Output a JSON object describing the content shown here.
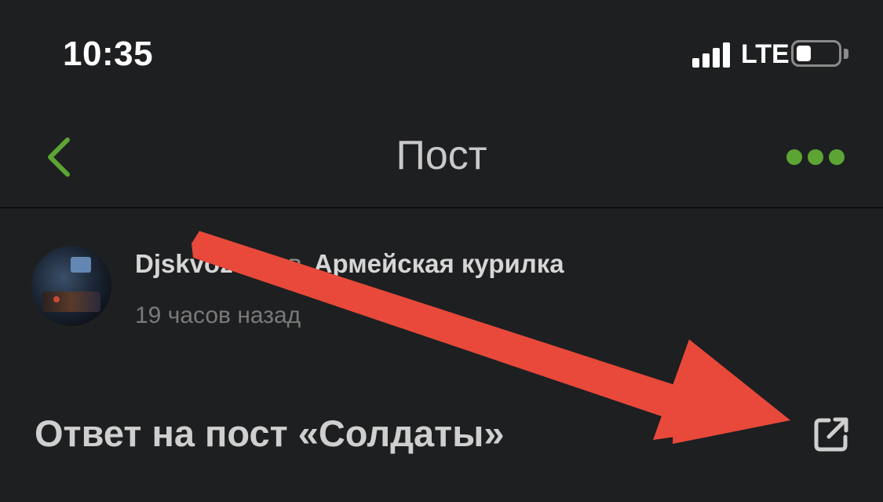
{
  "status_bar": {
    "time": "10:35",
    "network": "LTE",
    "battery_level": 0.35
  },
  "nav": {
    "back_icon": "chevron-left-icon",
    "title": "Пост",
    "more_icon": "more-dots-icon",
    "accent_color": "#5ca534"
  },
  "post": {
    "author": "Djskvozvak",
    "preposition": "в",
    "community": "Армейская курилка",
    "time_ago": "19 часов назад",
    "title": "Ответ на пост «Солдаты»",
    "share_icon": "share-external-icon"
  },
  "annotation": {
    "arrow_icon": "red-arrow-annotation",
    "color": "#e8493a"
  }
}
